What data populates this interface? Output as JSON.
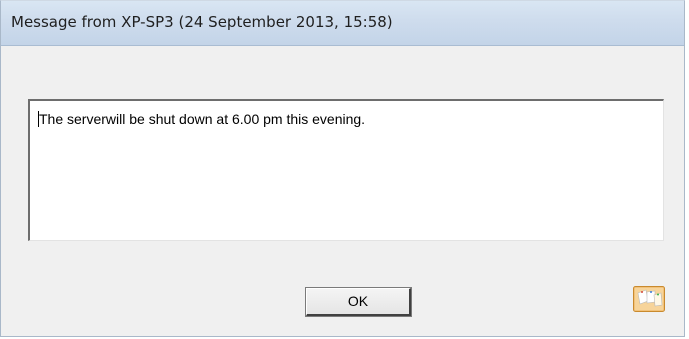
{
  "window": {
    "title": "Message from XP-SP3 (24 September 2013, 15:58)"
  },
  "message": {
    "text": "The serverwill be shut down at 6.00 pm this evening."
  },
  "buttons": {
    "ok_label": "OK"
  },
  "icons": {
    "corner": "messenger-note-icon"
  },
  "colors": {
    "titlebar": "#cedced",
    "dialog_background": "#f0f0f0",
    "icon_frame": "#e2a64a"
  }
}
